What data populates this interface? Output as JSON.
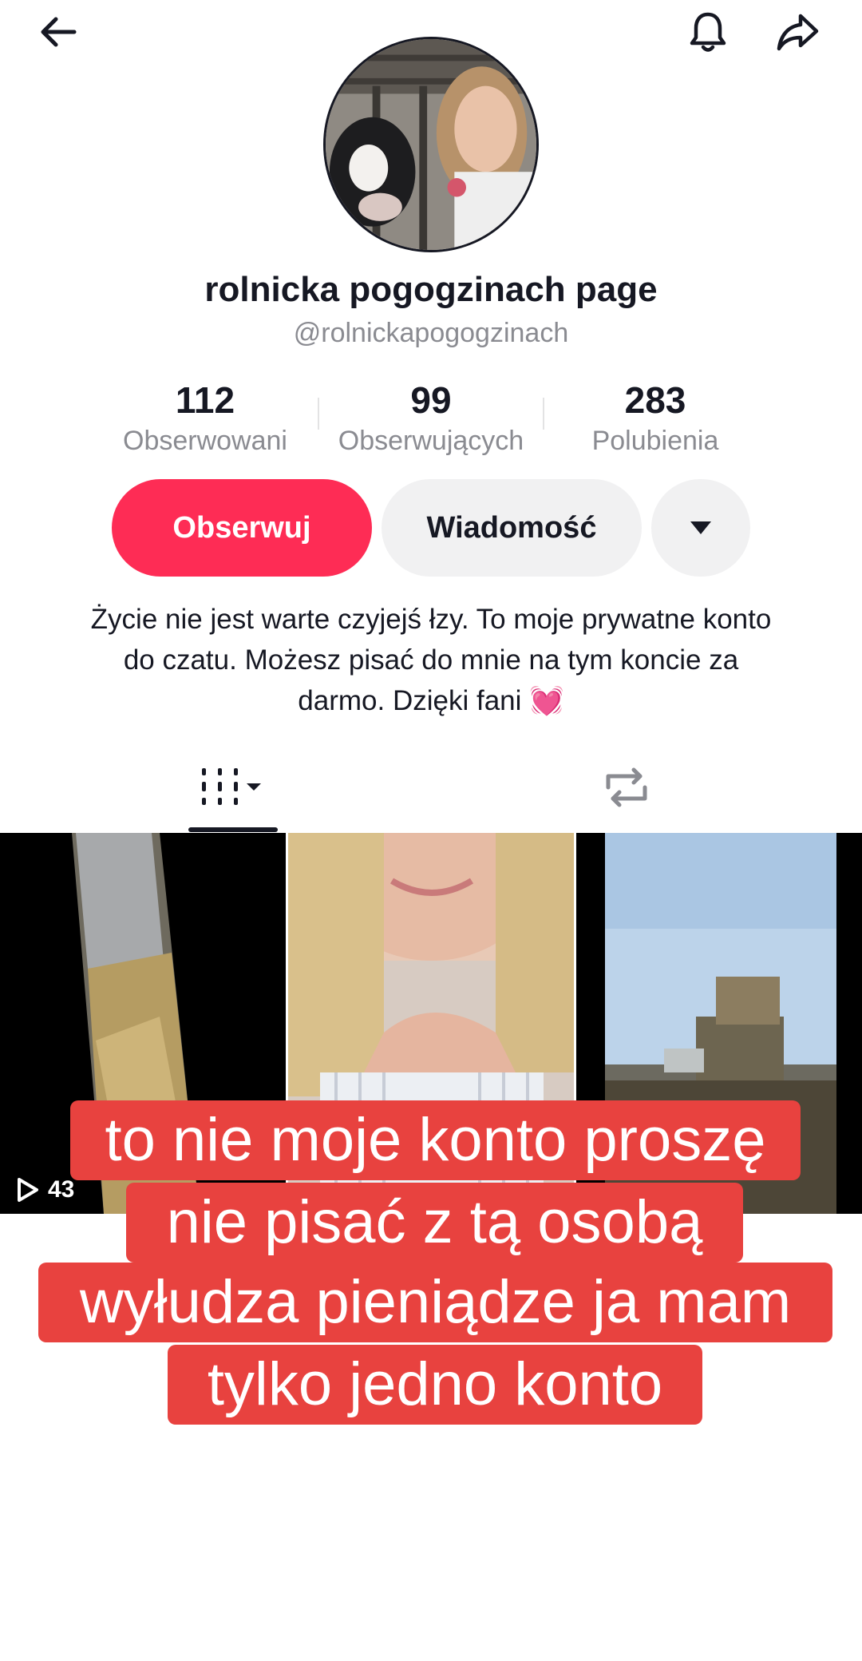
{
  "profile": {
    "display_name": "rolnicka pogogzinach page",
    "username": "@rolnickapogogzinach"
  },
  "stats": [
    {
      "value": "112",
      "label": "Obserwowani"
    },
    {
      "value": "99",
      "label": "Obserwujących"
    },
    {
      "value": "283",
      "label": "Polubienia"
    }
  ],
  "actions": {
    "follow_label": "Obserwuj",
    "message_label": "Wiadomość",
    "more_icon": "caret-down-icon"
  },
  "bio": "Życie nie jest warte czyjejś łzy. To moje prywatne konto do czatu. Możesz pisać do mnie na tym koncie za darmo. Dzięki fani 💓",
  "tabs": [
    {
      "name": "videos",
      "icon": "grid-icon"
    },
    {
      "name": "reposts",
      "icon": "repost-icon"
    }
  ],
  "videos": [
    {
      "views": "43"
    },
    {
      "views": ""
    },
    {
      "views": ""
    }
  ],
  "overlay_caption": [
    "to nie moje konto proszę",
    "nie  pisać  z tą osobą",
    "wyłudza pieniądze  ja mam",
    "tylko jedno konto"
  ],
  "colors": {
    "follow_button": "#fe2c55",
    "caption_background": "#e8423f",
    "secondary_button": "#f1f1f2"
  },
  "icons": {
    "back": "back-arrow-icon",
    "notifications": "bell-icon",
    "share": "share-icon"
  }
}
